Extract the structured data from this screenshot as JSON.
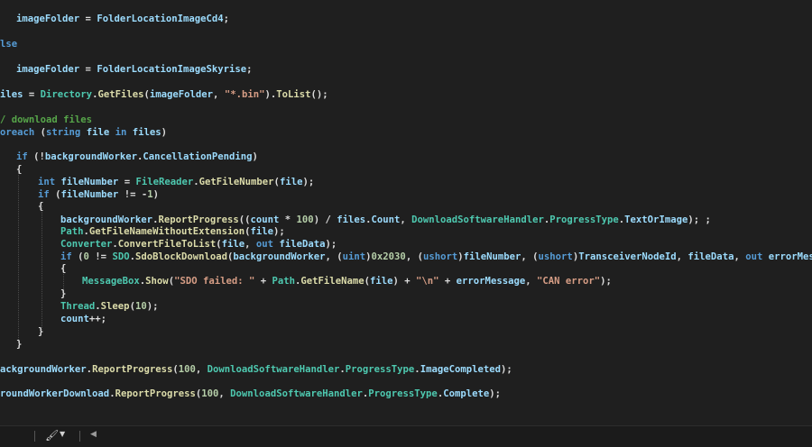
{
  "editor": {
    "lines": [
      [
        [
          "imageFolder",
          "vr"
        ],
        [
          " = ",
          "pl"
        ],
        [
          "FolderLocationImageCd4",
          "vr"
        ],
        [
          ";",
          "pl"
        ]
      ],
      [
        [
          "lse",
          "kw"
        ]
      ],
      [
        [
          "imageFolder",
          "vr"
        ],
        [
          " = ",
          "pl"
        ],
        [
          "FolderLocationImageSkyrise",
          "vr"
        ],
        [
          ";",
          "pl"
        ]
      ],
      [
        [
          "iles",
          "vr"
        ],
        [
          " = ",
          "pl"
        ],
        [
          "Directory",
          "ty"
        ],
        [
          ".",
          "pl"
        ],
        [
          "GetFiles",
          "mt"
        ],
        [
          "(",
          "pl"
        ],
        [
          "imageFolder",
          "vr"
        ],
        [
          ", ",
          "pl"
        ],
        [
          "\"*.bin\"",
          "st"
        ],
        [
          ").",
          "pl"
        ],
        [
          "ToList",
          "mt"
        ],
        [
          "();",
          "pl"
        ]
      ],
      [
        [
          "/ download files",
          "cm"
        ]
      ],
      [
        [
          "oreach",
          "kw"
        ],
        [
          " (",
          "pl"
        ],
        [
          "string",
          "kw"
        ],
        [
          " ",
          "pl"
        ],
        [
          "file",
          "vr"
        ],
        [
          " ",
          "pl"
        ],
        [
          "in",
          "kw"
        ],
        [
          " ",
          "pl"
        ],
        [
          "files",
          "vr"
        ],
        [
          ")",
          "pl"
        ]
      ],
      [
        [
          "if",
          "kw"
        ],
        [
          " (!",
          "pl"
        ],
        [
          "backgroundWorker",
          "vr"
        ],
        [
          ".",
          "pl"
        ],
        [
          "CancellationPending",
          "vr"
        ],
        [
          ")",
          "pl"
        ]
      ],
      [
        [
          "{",
          "pl"
        ]
      ],
      [
        [
          "int",
          "kw"
        ],
        [
          " ",
          "pl"
        ],
        [
          "fileNumber",
          "vr"
        ],
        [
          " = ",
          "pl"
        ],
        [
          "FileReader",
          "ty"
        ],
        [
          ".",
          "pl"
        ],
        [
          "GetFileNumber",
          "mt"
        ],
        [
          "(",
          "pl"
        ],
        [
          "file",
          "vr"
        ],
        [
          ");",
          "pl"
        ]
      ],
      [
        [
          "if",
          "kw"
        ],
        [
          " (",
          "pl"
        ],
        [
          "fileNumber",
          "vr"
        ],
        [
          " != -",
          "pl"
        ],
        [
          "1",
          "nm"
        ],
        [
          ")",
          "pl"
        ]
      ],
      [
        [
          "{",
          "pl"
        ]
      ],
      [
        [
          "backgroundWorker",
          "vr"
        ],
        [
          ".",
          "pl"
        ],
        [
          "ReportProgress",
          "mt"
        ],
        [
          "((",
          "pl"
        ],
        [
          "count",
          "vr"
        ],
        [
          " * ",
          "pl"
        ],
        [
          "100",
          "nm"
        ],
        [
          ") / ",
          "pl"
        ],
        [
          "files",
          "vr"
        ],
        [
          ".",
          "pl"
        ],
        [
          "Count",
          "vr"
        ],
        [
          ", ",
          "pl"
        ],
        [
          "DownloadSoftwareHandler",
          "ty"
        ],
        [
          ".",
          "pl"
        ],
        [
          "ProgressType",
          "ty"
        ],
        [
          ".",
          "pl"
        ],
        [
          "TextOrImage",
          "vr"
        ],
        [
          "); ;",
          "pl"
        ]
      ],
      [
        [
          "Path",
          "ty"
        ],
        [
          ".",
          "pl"
        ],
        [
          "GetFileNameWithoutExtension",
          "mt"
        ],
        [
          "(",
          "pl"
        ],
        [
          "file",
          "vr"
        ],
        [
          ");",
          "pl"
        ]
      ],
      [
        [
          "Converter",
          "ty"
        ],
        [
          ".",
          "pl"
        ],
        [
          "ConvertFileToList",
          "mt"
        ],
        [
          "(",
          "pl"
        ],
        [
          "file",
          "vr"
        ],
        [
          ", ",
          "pl"
        ],
        [
          "out",
          "kw"
        ],
        [
          " ",
          "pl"
        ],
        [
          "fileData",
          "vr"
        ],
        [
          ");",
          "pl"
        ]
      ],
      [
        [
          "if",
          "kw"
        ],
        [
          " (",
          "pl"
        ],
        [
          "0",
          "nm"
        ],
        [
          " != ",
          "pl"
        ],
        [
          "SDO",
          "ty"
        ],
        [
          ".",
          "pl"
        ],
        [
          "SdoBlockDownload",
          "mt"
        ],
        [
          "(",
          "pl"
        ],
        [
          "backgroundWorker",
          "vr"
        ],
        [
          ", (",
          "pl"
        ],
        [
          "uint",
          "kw"
        ],
        [
          ")",
          "pl"
        ],
        [
          "0x2030",
          "nm"
        ],
        [
          ", (",
          "pl"
        ],
        [
          "ushort",
          "kw"
        ],
        [
          ")",
          "pl"
        ],
        [
          "fileNumber",
          "vr"
        ],
        [
          ", (",
          "pl"
        ],
        [
          "ushort",
          "kw"
        ],
        [
          ")",
          "pl"
        ],
        [
          "TransceiverNodeId",
          "vr"
        ],
        [
          ", ",
          "pl"
        ],
        [
          "fileData",
          "vr"
        ],
        [
          ", ",
          "pl"
        ],
        [
          "out",
          "kw"
        ],
        [
          " ",
          "pl"
        ],
        [
          "errorMessage",
          "vr"
        ],
        [
          ")",
          "pl"
        ]
      ],
      [
        [
          "{",
          "pl"
        ]
      ],
      [
        [
          "MessageBox",
          "ty"
        ],
        [
          ".",
          "pl"
        ],
        [
          "Show",
          "mt"
        ],
        [
          "(",
          "pl"
        ],
        [
          "\"SDO failed: \"",
          "st"
        ],
        [
          " + ",
          "pl"
        ],
        [
          "Path",
          "ty"
        ],
        [
          ".",
          "pl"
        ],
        [
          "GetFileName",
          "mt"
        ],
        [
          "(",
          "pl"
        ],
        [
          "file",
          "vr"
        ],
        [
          ") + ",
          "pl"
        ],
        [
          "\"\\n\"",
          "st"
        ],
        [
          " + ",
          "pl"
        ],
        [
          "errorMessage",
          "vr"
        ],
        [
          ", ",
          "pl"
        ],
        [
          "\"CAN error\"",
          "st"
        ],
        [
          ");",
          "pl"
        ]
      ],
      [
        [
          "}",
          "pl"
        ]
      ],
      [
        [
          "Thread",
          "ty"
        ],
        [
          ".",
          "pl"
        ],
        [
          "Sleep",
          "mt"
        ],
        [
          "(",
          "pl"
        ],
        [
          "10",
          "nm"
        ],
        [
          ");",
          "pl"
        ]
      ],
      [
        [
          "count",
          "vr"
        ],
        [
          "++;",
          "pl"
        ]
      ],
      [
        [
          "}",
          "pl"
        ]
      ],
      [
        [
          "}",
          "pl"
        ]
      ],
      [
        [
          "ackgroundWorker",
          "vr"
        ],
        [
          ".",
          "pl"
        ],
        [
          "ReportProgress",
          "mt"
        ],
        [
          "(",
          "pl"
        ],
        [
          "100",
          "nm"
        ],
        [
          ", ",
          "pl"
        ],
        [
          "DownloadSoftwareHandler",
          "ty"
        ],
        [
          ".",
          "pl"
        ],
        [
          "ProgressType",
          "ty"
        ],
        [
          ".",
          "pl"
        ],
        [
          "ImageCompleted",
          "vr"
        ],
        [
          ");",
          "pl"
        ]
      ],
      [
        [
          "roundWorkerDownload",
          "vr"
        ],
        [
          ".",
          "pl"
        ],
        [
          "ReportProgress",
          "mt"
        ],
        [
          "(",
          "pl"
        ],
        [
          "100",
          "nm"
        ],
        [
          ", ",
          "pl"
        ],
        [
          "DownloadSoftwareHandler",
          "ty"
        ],
        [
          ".",
          "pl"
        ],
        [
          "ProgressType",
          "ty"
        ],
        [
          ".",
          "pl"
        ],
        [
          "Complete",
          "vr"
        ],
        [
          ");",
          "pl"
        ]
      ]
    ]
  },
  "status_bar": {
    "brush_icon": "paintbrush-icon",
    "dropdown_icon": "caret-down-icon",
    "scroll_left_icon": "triangle-left-icon"
  },
  "colors": {
    "background": "#1f1f1f",
    "keyword": "#569cd6",
    "type": "#4ec9b0",
    "method": "#dcdcaa",
    "variable": "#9cdcfe",
    "string": "#d69d85",
    "number": "#b5cea8",
    "comment": "#57a64a"
  }
}
